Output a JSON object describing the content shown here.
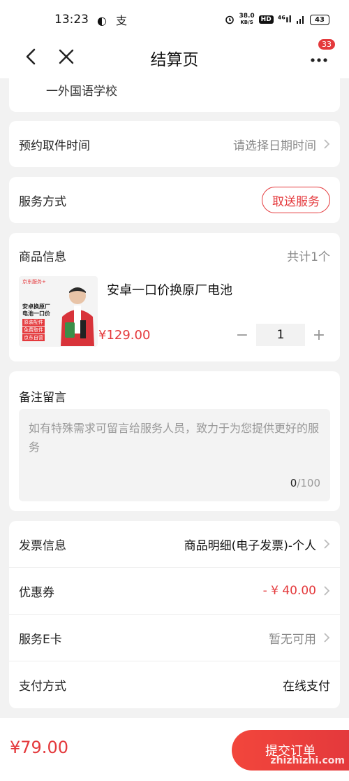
{
  "status_bar": {
    "time": "13:23",
    "apps": "◐ 支",
    "net_speed_top": "38.0",
    "net_speed_bottom": "KB/S",
    "hd": "HD",
    "signal": "⁴⁶ıl",
    "battery": "43"
  },
  "nav": {
    "title": "结算页",
    "badge": "33"
  },
  "address": {
    "text": "一外国语学校"
  },
  "pickup": {
    "label": "预约取件时间",
    "placeholder": "请选择日期时间"
  },
  "service": {
    "label": "服务方式",
    "button": "取送服务"
  },
  "goods": {
    "title": "商品信息",
    "count": "共计1个",
    "name": "安卓一口价换原厂电池",
    "price": "¥129.00",
    "quantity": "1",
    "minus": "−",
    "plus": "+",
    "image_brand": "京东服务+",
    "image_line1": "安卓换原厂",
    "image_line2": "电池一口价",
    "image_tag1": "原装配件",
    "image_tag2": "免费取件",
    "image_tag3": "京东自营"
  },
  "note": {
    "title": "备注留言",
    "placeholder": "如有特殊需求可留言给服务人员，致力于为您提供更好的服务",
    "count_current": "0",
    "count_max": "/100"
  },
  "info": {
    "invoice_label": "发票信息",
    "invoice_value": "商品明细(电子发票)-个人",
    "coupon_label": "优惠券",
    "coupon_value": "- ¥ 40.00",
    "ecard_label": "服务E卡",
    "ecard_value": "暂无可用",
    "payment_label": "支付方式",
    "payment_value": "在线支付"
  },
  "footer": {
    "total": "¥79.00",
    "submit": "提交订单",
    "watermark": "zhizhizhi.com"
  },
  "colors": {
    "accent": "#e4393c"
  }
}
